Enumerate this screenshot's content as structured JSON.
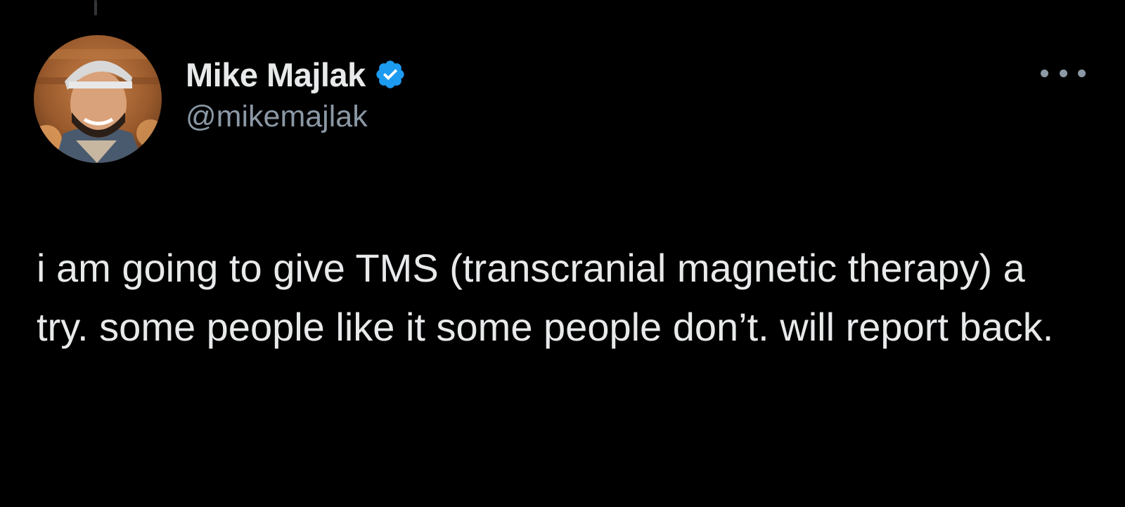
{
  "tweet": {
    "author": {
      "display_name": "Mike Majlak",
      "handle": "@mikemajlak",
      "verified": true,
      "avatar_icon": "profile-photo"
    },
    "more_icon": "ellipsis-icon",
    "text": "i am going to give TMS (transcranial magnetic therapy) a try. some people like it some people don’t. will report back."
  },
  "colors": {
    "background": "#000000",
    "primary_text": "#e7e9ea",
    "secondary_text": "#8b98a5",
    "verified_badge": "#1d9bf0"
  }
}
